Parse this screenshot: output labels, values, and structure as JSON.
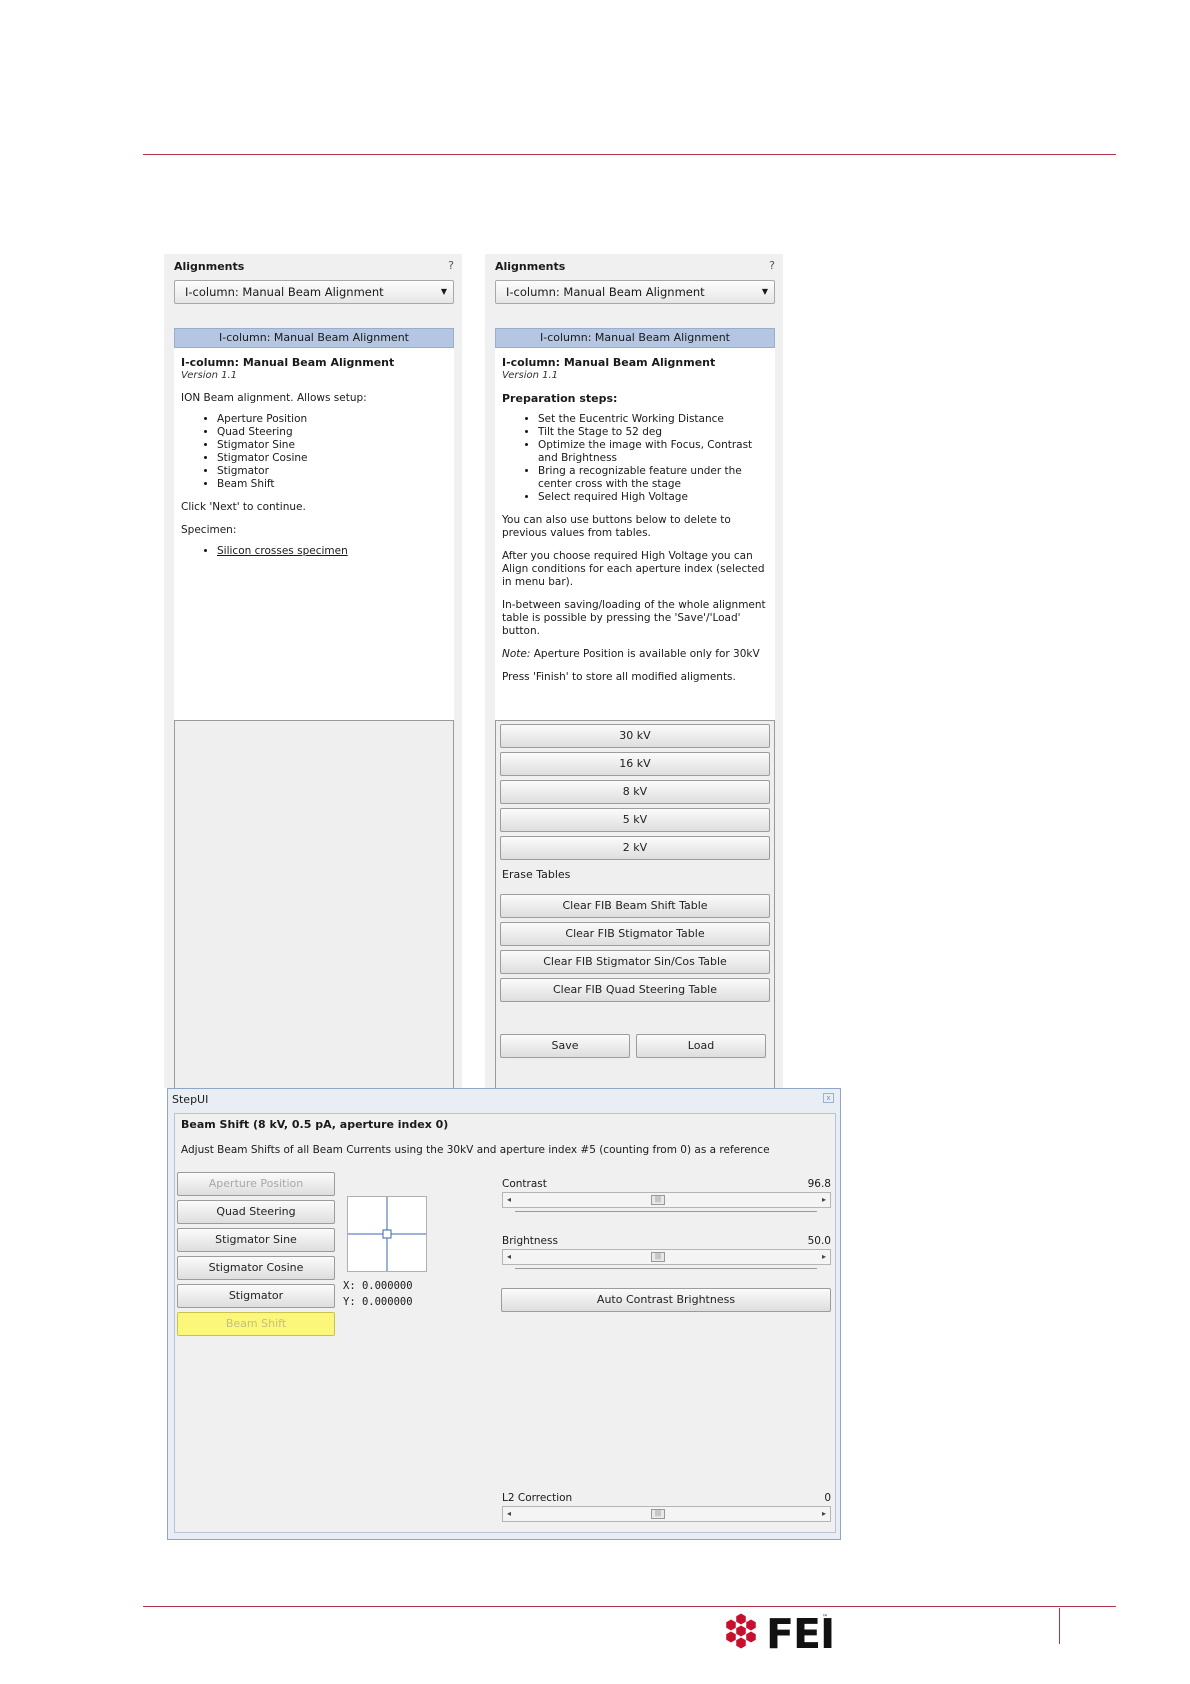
{
  "left_panel": {
    "title": "Alignments",
    "help": "?",
    "dropdown_value": "I-column: Manual Beam Alignment",
    "strip_title": "I-column: Manual Beam Alignment",
    "heading": "I-column: Manual Beam Alignment",
    "version": "Version 1.1",
    "intro": "ION Beam alignment. Allows setup:",
    "items": [
      "Aperture Position",
      "Quad Steering",
      "Stigmator Sine",
      "Stigmator Cosine",
      "Stigmator",
      "Beam Shift"
    ],
    "continue_text": "Click 'Next' to continue.",
    "specimen_label": "Specimen:",
    "specimen_link": "Silicon crosses specimen"
  },
  "right_panel": {
    "title": "Alignments",
    "help": "?",
    "dropdown_value": "I-column: Manual Beam Alignment",
    "strip_title": "I-column: Manual Beam Alignment",
    "heading": "I-column: Manual Beam Alignment",
    "version": "Version 1.1",
    "prep_heading": "Preparation steps:",
    "prep_items": [
      "Set the Eucentric Working Distance",
      "Tilt the Stage to 52 deg",
      "Optimize the image with Focus, Contrast and Brightness",
      "Bring a recognizable feature under the center cross with the stage",
      "Select required High Voltage"
    ],
    "para1": "You can also use buttons below to delete to previous values from tables.",
    "para2": "After you choose required High Voltage you can Align conditions for each aperture index (selected in menu bar).",
    "para3": "In-between saving/loading of the whole alignment table is possible by pressing the 'Save'/'Load' button.",
    "note_label": "Note:",
    "note_text": " Aperture Position is available only for 30kV",
    "para4": "Press 'Finish' to store all modified aligments.",
    "kv_buttons": [
      "30 kV",
      "16 kV",
      "8 kV",
      "5 kV",
      "2 kV"
    ],
    "erase_label": "Erase Tables",
    "clear_buttons": [
      "Clear FIB Beam Shift Table",
      "Clear FIB Stigmator Table",
      "Clear FIB Stigmator Sin/Cos Table",
      "Clear FIB Quad Steering Table"
    ],
    "save_label": "Save",
    "load_label": "Load"
  },
  "stepui": {
    "title": "StepUI",
    "close_icon": "x",
    "heading": "Beam Shift (8 kV, 0.5 pA, aperture index 0)",
    "description": "Adjust Beam Shifts of all Beam Currents using the 30kV and aperture index #5 (counting from 0) as a reference",
    "steps": [
      "Aperture Position",
      "Quad Steering",
      "Stigmator Sine",
      "Stigmator Cosine",
      "Stigmator",
      "Beam Shift"
    ],
    "x_readout": "X: 0.000000",
    "y_readout": "Y: 0.000000",
    "contrast_label": "Contrast",
    "contrast_value": "96.8",
    "brightness_label": "Brightness",
    "brightness_value": "50.0",
    "auto_button": "Auto Contrast Brightness",
    "l2_label": "L2 Correction",
    "l2_value": "0",
    "thumb_glyph": "|||"
  },
  "footer": {
    "logo_text": "FEI",
    "logo_tm": "™",
    "logo_color": "#c8102e"
  }
}
